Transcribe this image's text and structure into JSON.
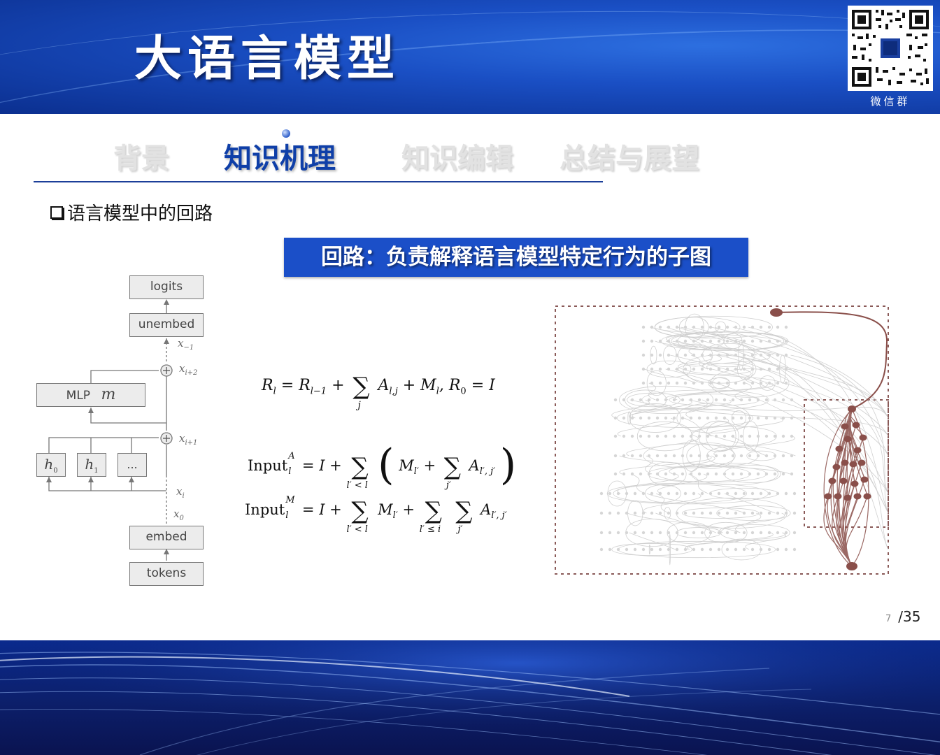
{
  "header": {
    "title": "大语言模型",
    "qr_label": "微信群"
  },
  "nav": {
    "tabs": [
      {
        "label": "背景",
        "active": false
      },
      {
        "label": "知识机理",
        "active": true
      },
      {
        "label": "知识编辑",
        "active": false
      },
      {
        "label": "总结与展望",
        "active": false
      }
    ]
  },
  "content": {
    "bullet": "语言模型中的回路",
    "banner": "回路：负责解释语言模型特定行为的子图"
  },
  "diagram": {
    "boxes": {
      "logits": "logits",
      "unembed": "unembed",
      "mlp": "MLP",
      "mlp_symbol": "m",
      "head0": "h",
      "head0_sub": "0",
      "head1": "h",
      "head1_sub": "1",
      "head_more": "...",
      "embed": "embed",
      "tokens": "tokens"
    },
    "labels": {
      "x_last": "x",
      "x_last_sub": "−1",
      "x_i2": "x",
      "x_i2_sub": "i+2",
      "x_i1": "x",
      "x_i1_sub": "i+1",
      "x_i": "x",
      "x_i_sub": "i",
      "x_0": "x",
      "x_0_sub": "0"
    }
  },
  "formulas": {
    "f1": {
      "lhs": "R",
      "lhs_sub": "l",
      "eq": "= R",
      "r_sub": "l−1",
      "plus": "+",
      "sum_sub": "j",
      "a": "A",
      "a_sub": "l,j",
      "rest": "+ M",
      "m_sub": "l",
      "tail": ", R",
      "r0_sub": "0",
      "end": "= I"
    },
    "f2": {
      "lhs": "Input",
      "sup": "A",
      "sub": "l",
      "eq": "= I +",
      "sum1_sub": "l′ < l",
      "m": "M",
      "m_sub": "l′",
      "plus": "+",
      "sum2_sub": "j′",
      "a": "A",
      "a_sub": "l′, j′"
    },
    "f3": {
      "lhs": "Input",
      "sup": "M",
      "sub": "l",
      "eq": "= I +",
      "sum1_sub": "l′ < l",
      "m": "M",
      "m_sub": "l′",
      "plus": "+",
      "sum2_sub": "l′ ≤ i",
      "sum3_sub": "j′",
      "a": "A",
      "a_sub": "l′, j′"
    }
  },
  "pagination": {
    "current": "7",
    "total": "/35"
  },
  "colors": {
    "header_blue": "#1a4fc4",
    "active_tab": "#0f3fa8",
    "banner_blue": "#1b4fc8",
    "circuit_node": "#8a4f4a"
  }
}
